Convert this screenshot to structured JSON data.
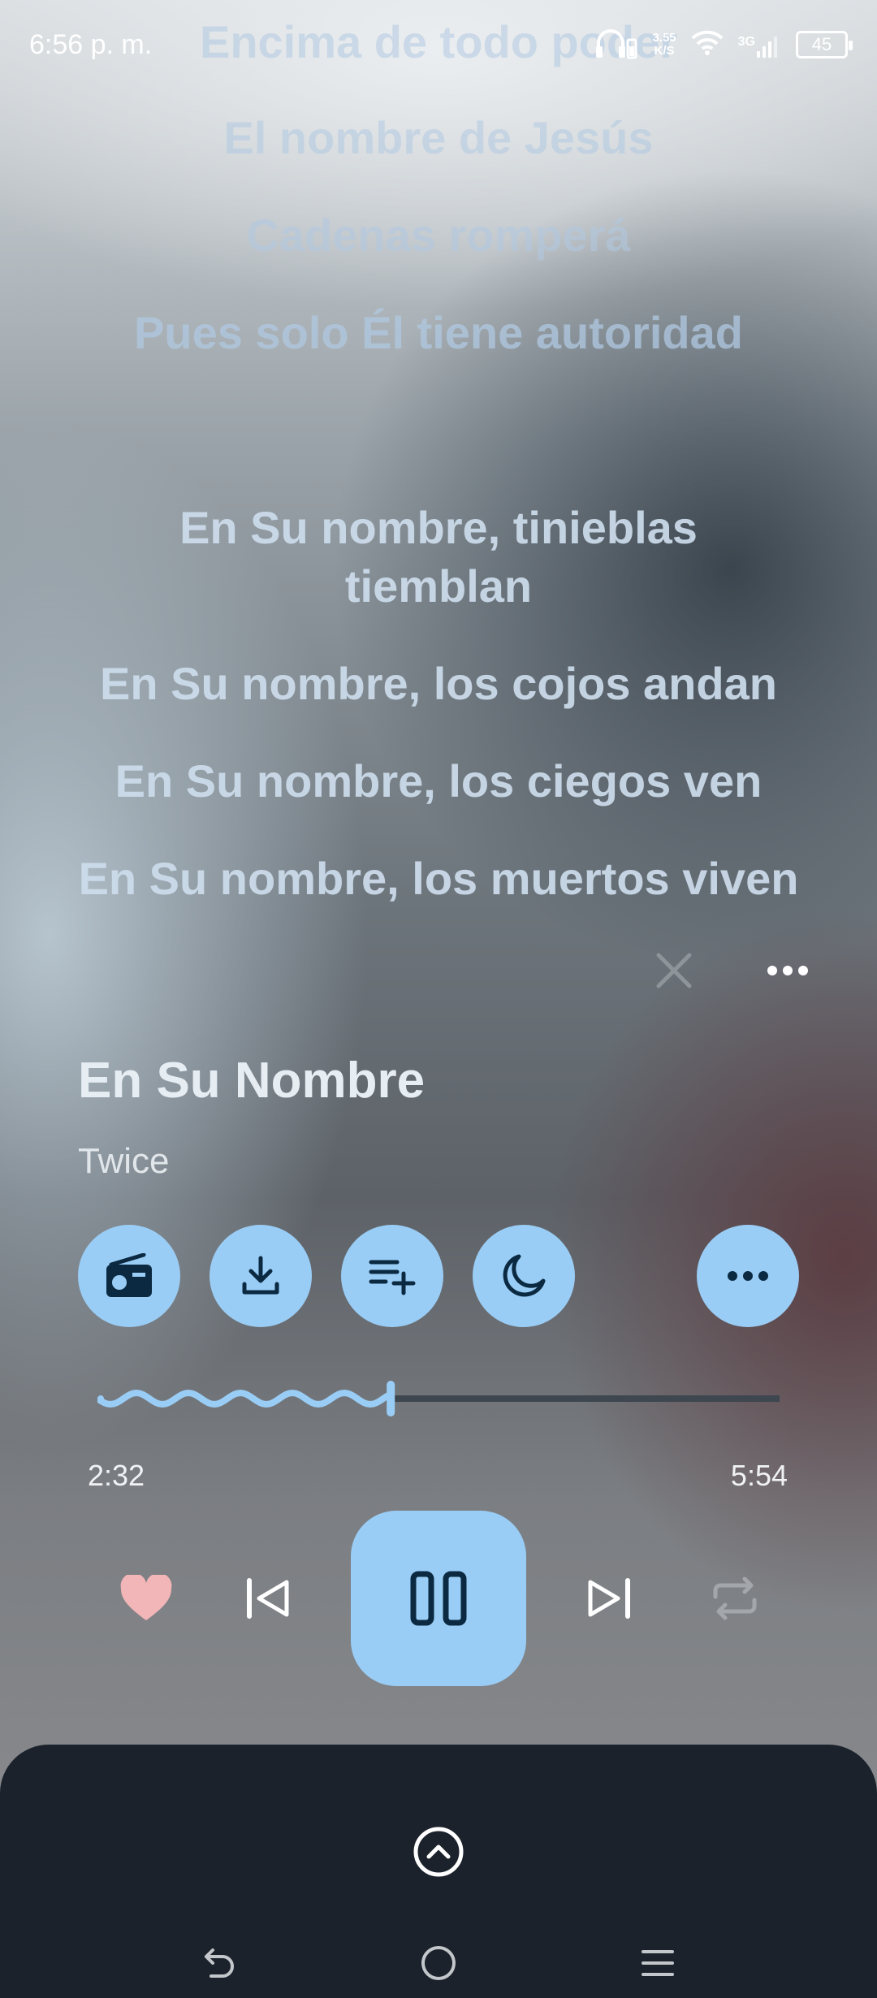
{
  "status_bar": {
    "time": "6:56 p. m.",
    "net_speed_value": "3.55",
    "net_speed_unit": "K/S",
    "network_type": "3G",
    "battery": "45",
    "icons": [
      "headphones-icon",
      "wifi-icon",
      "signal-icon",
      "battery-icon"
    ]
  },
  "lyrics": {
    "lines": [
      "Encima de todo poder",
      "El nombre de Jesús",
      "Cadenas romperá",
      "Pues solo Él tiene autoridad",
      "En Su nombre, tinieblas tiemblan",
      "En Su nombre, los cojos andan",
      "En Su nombre, los ciegos ven",
      "En Su nombre, los muertos viven"
    ]
  },
  "player": {
    "title": "En Su Nombre",
    "artist": "Twice",
    "actions": [
      "radio-icon",
      "download-icon",
      "add-to-playlist-icon",
      "sleep-timer-icon",
      "more-icon"
    ],
    "progress": 0.43,
    "elapsed": "2:32",
    "duration": "5:54",
    "is_playing": true,
    "liked": true
  },
  "colors": {
    "accent": "#9acdf5",
    "heart": "#f3b6b8",
    "sheet": "#1b222b",
    "icon_dark": "#0b2a42"
  }
}
